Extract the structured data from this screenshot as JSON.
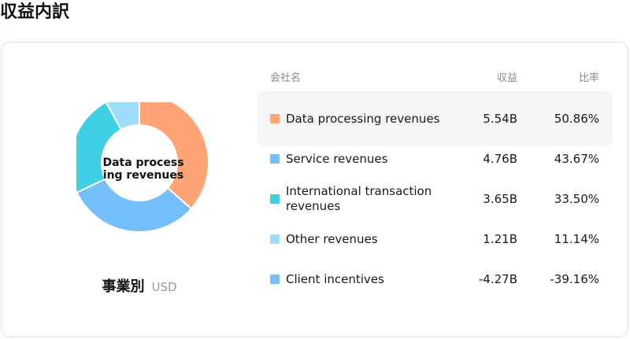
{
  "page": {
    "title": "収益内訳"
  },
  "donut": {
    "center_label": "Data processing revenues",
    "segment_title": "事業別",
    "currency": "USD"
  },
  "table": {
    "headers": {
      "company": "会社名",
      "revenue": "収益",
      "ratio": "比率"
    },
    "rows": [
      {
        "name": "Data processing revenues",
        "revenue": "5.54B",
        "ratio": "50.86%",
        "color": "#ffa474",
        "highlighted": true
      },
      {
        "name": "Service revenues",
        "revenue": "4.76B",
        "ratio": "43.67%",
        "color": "#74bff9",
        "highlighted": false
      },
      {
        "name": "International transaction revenues",
        "revenue": "3.65B",
        "ratio": "33.50%",
        "color": "#40d0e6",
        "highlighted": false
      },
      {
        "name": "Other revenues",
        "revenue": "1.21B",
        "ratio": "11.14%",
        "color": "#9ddcfb",
        "highlighted": false
      },
      {
        "name": "Client incentives",
        "revenue": "-4.27B",
        "ratio": "-39.16%",
        "color": "#74bff9",
        "highlighted": false
      }
    ]
  },
  "chart_data": {
    "type": "pie",
    "labels": [
      "Data processing revenues",
      "Service revenues",
      "International transaction revenues",
      "Other revenues"
    ],
    "values": [
      5.54,
      4.76,
      3.65,
      1.21
    ],
    "colors": [
      "#ffa474",
      "#74bff9",
      "#40d0e6",
      "#9ddcfb"
    ],
    "center_label": "Data processing revenues"
  }
}
